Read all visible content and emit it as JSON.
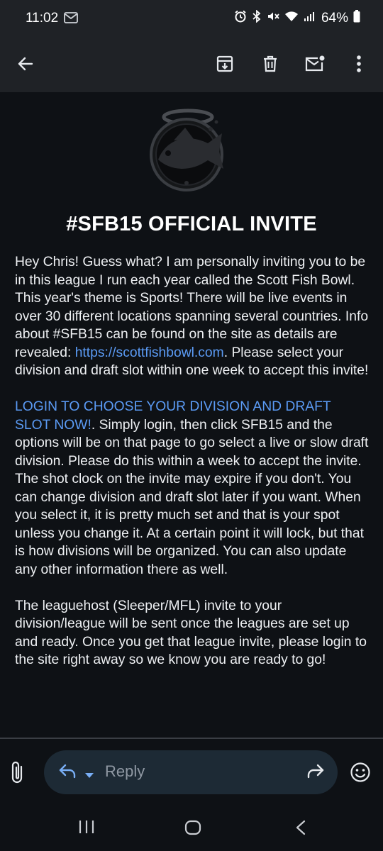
{
  "status_bar": {
    "time": "11:02",
    "battery": "64%",
    "icons": [
      "gmail-icon",
      "alarm-icon",
      "bluetooth-icon",
      "mute-icon",
      "wifi-icon",
      "signal-icon",
      "battery-icon"
    ]
  },
  "toolbar": {
    "icons": [
      "back-arrow-icon",
      "archive-icon",
      "delete-icon",
      "mark-unread-icon",
      "more-vert-icon"
    ]
  },
  "email": {
    "title": "#SFB15 OFFICIAL INVITE",
    "p1_text": "Hey Chris! Guess what? I am personally inviting you to be in this league I run each year called the Scott Fish Bowl. This year's theme is Sports! There will be live events in over 30 different locations spanning several countries. Info about #SFB15 can be found on the site as details are revealed: ",
    "p1_link": "https://scottfishbowl.com",
    "p1_after": ". Please select your division and draft slot within one week to accept this invite!",
    "p2_link": "LOGIN TO CHOOSE YOUR DIVISION AND DRAFT SLOT NOW!",
    "p2_text": ". Simply login, then click SFB15 and the options will be on that page to go select a live or slow draft division. Please do this within a week to accept the invite. The shot clock on the invite may expire if you don't. You can change division and draft slot later if you want. When you select it, it is pretty much set and that is your spot unless you change it. At a certain point it will lock, but that is how divisions will be organized. You can also update any other information there as well.",
    "p3_text": "The leaguehost (Sleeper/MFL) invite to your division/league will be sent once the leagues are set up and ready. Once you get that league invite, please login to the site right away so we know you are ready to go!"
  },
  "reply_bar": {
    "reply_label": "Reply"
  },
  "colors": {
    "background": "#0e1115",
    "toolbar": "#1f2226",
    "link": "#5b9bf5",
    "reply_pill": "#1d2a35"
  }
}
